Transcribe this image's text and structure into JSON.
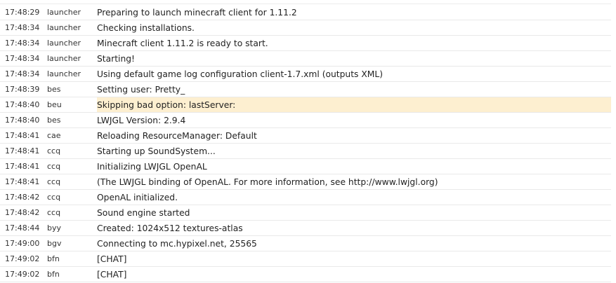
{
  "colors": {
    "warning_row": "#fdefd0",
    "row_divider": "#e9e9e9"
  },
  "log": {
    "rows": [
      {
        "time": "17:48:29",
        "source": "launcher",
        "message": "Preparing to launch minecraft client for 1.11.2"
      },
      {
        "time": "17:48:34",
        "source": "launcher",
        "message": "Checking installations."
      },
      {
        "time": "17:48:34",
        "source": "launcher",
        "message": "Minecraft client 1.11.2 is ready to start."
      },
      {
        "time": "17:48:34",
        "source": "launcher",
        "message": "Starting!"
      },
      {
        "time": "17:48:34",
        "source": "launcher",
        "message": "Using default game log configuration client-1.7.xml (outputs XML)"
      },
      {
        "time": "17:48:39",
        "source": "bes",
        "message": "Setting user: Pretty_"
      },
      {
        "time": "17:48:40",
        "source": "beu",
        "message": "Skipping bad option: lastServer:"
      },
      {
        "time": "17:48:40",
        "source": "bes",
        "message": "LWJGL Version: 2.9.4"
      },
      {
        "time": "17:48:41",
        "source": "cae",
        "message": "Reloading ResourceManager: Default"
      },
      {
        "time": "17:48:41",
        "source": "ccq",
        "message": "Starting up SoundSystem..."
      },
      {
        "time": "17:48:41",
        "source": "ccq",
        "message": "Initializing LWJGL OpenAL"
      },
      {
        "time": "17:48:41",
        "source": "ccq",
        "message": "(The LWJGL binding of OpenAL.  For more information, see http://www.lwjgl.org)"
      },
      {
        "time": "17:48:42",
        "source": "ccq",
        "message": "OpenAL initialized."
      },
      {
        "time": "17:48:42",
        "source": "ccq",
        "message": "Sound engine started"
      },
      {
        "time": "17:48:44",
        "source": "byy",
        "message": "Created: 1024x512 textures-atlas"
      },
      {
        "time": "17:49:00",
        "source": "bgv",
        "message": "Connecting to mc.hypixel.net, 25565"
      },
      {
        "time": "17:49:02",
        "source": "bfn",
        "message": "[CHAT]"
      },
      {
        "time": "17:49:02",
        "source": "bfn",
        "message": "[CHAT]"
      }
    ]
  }
}
